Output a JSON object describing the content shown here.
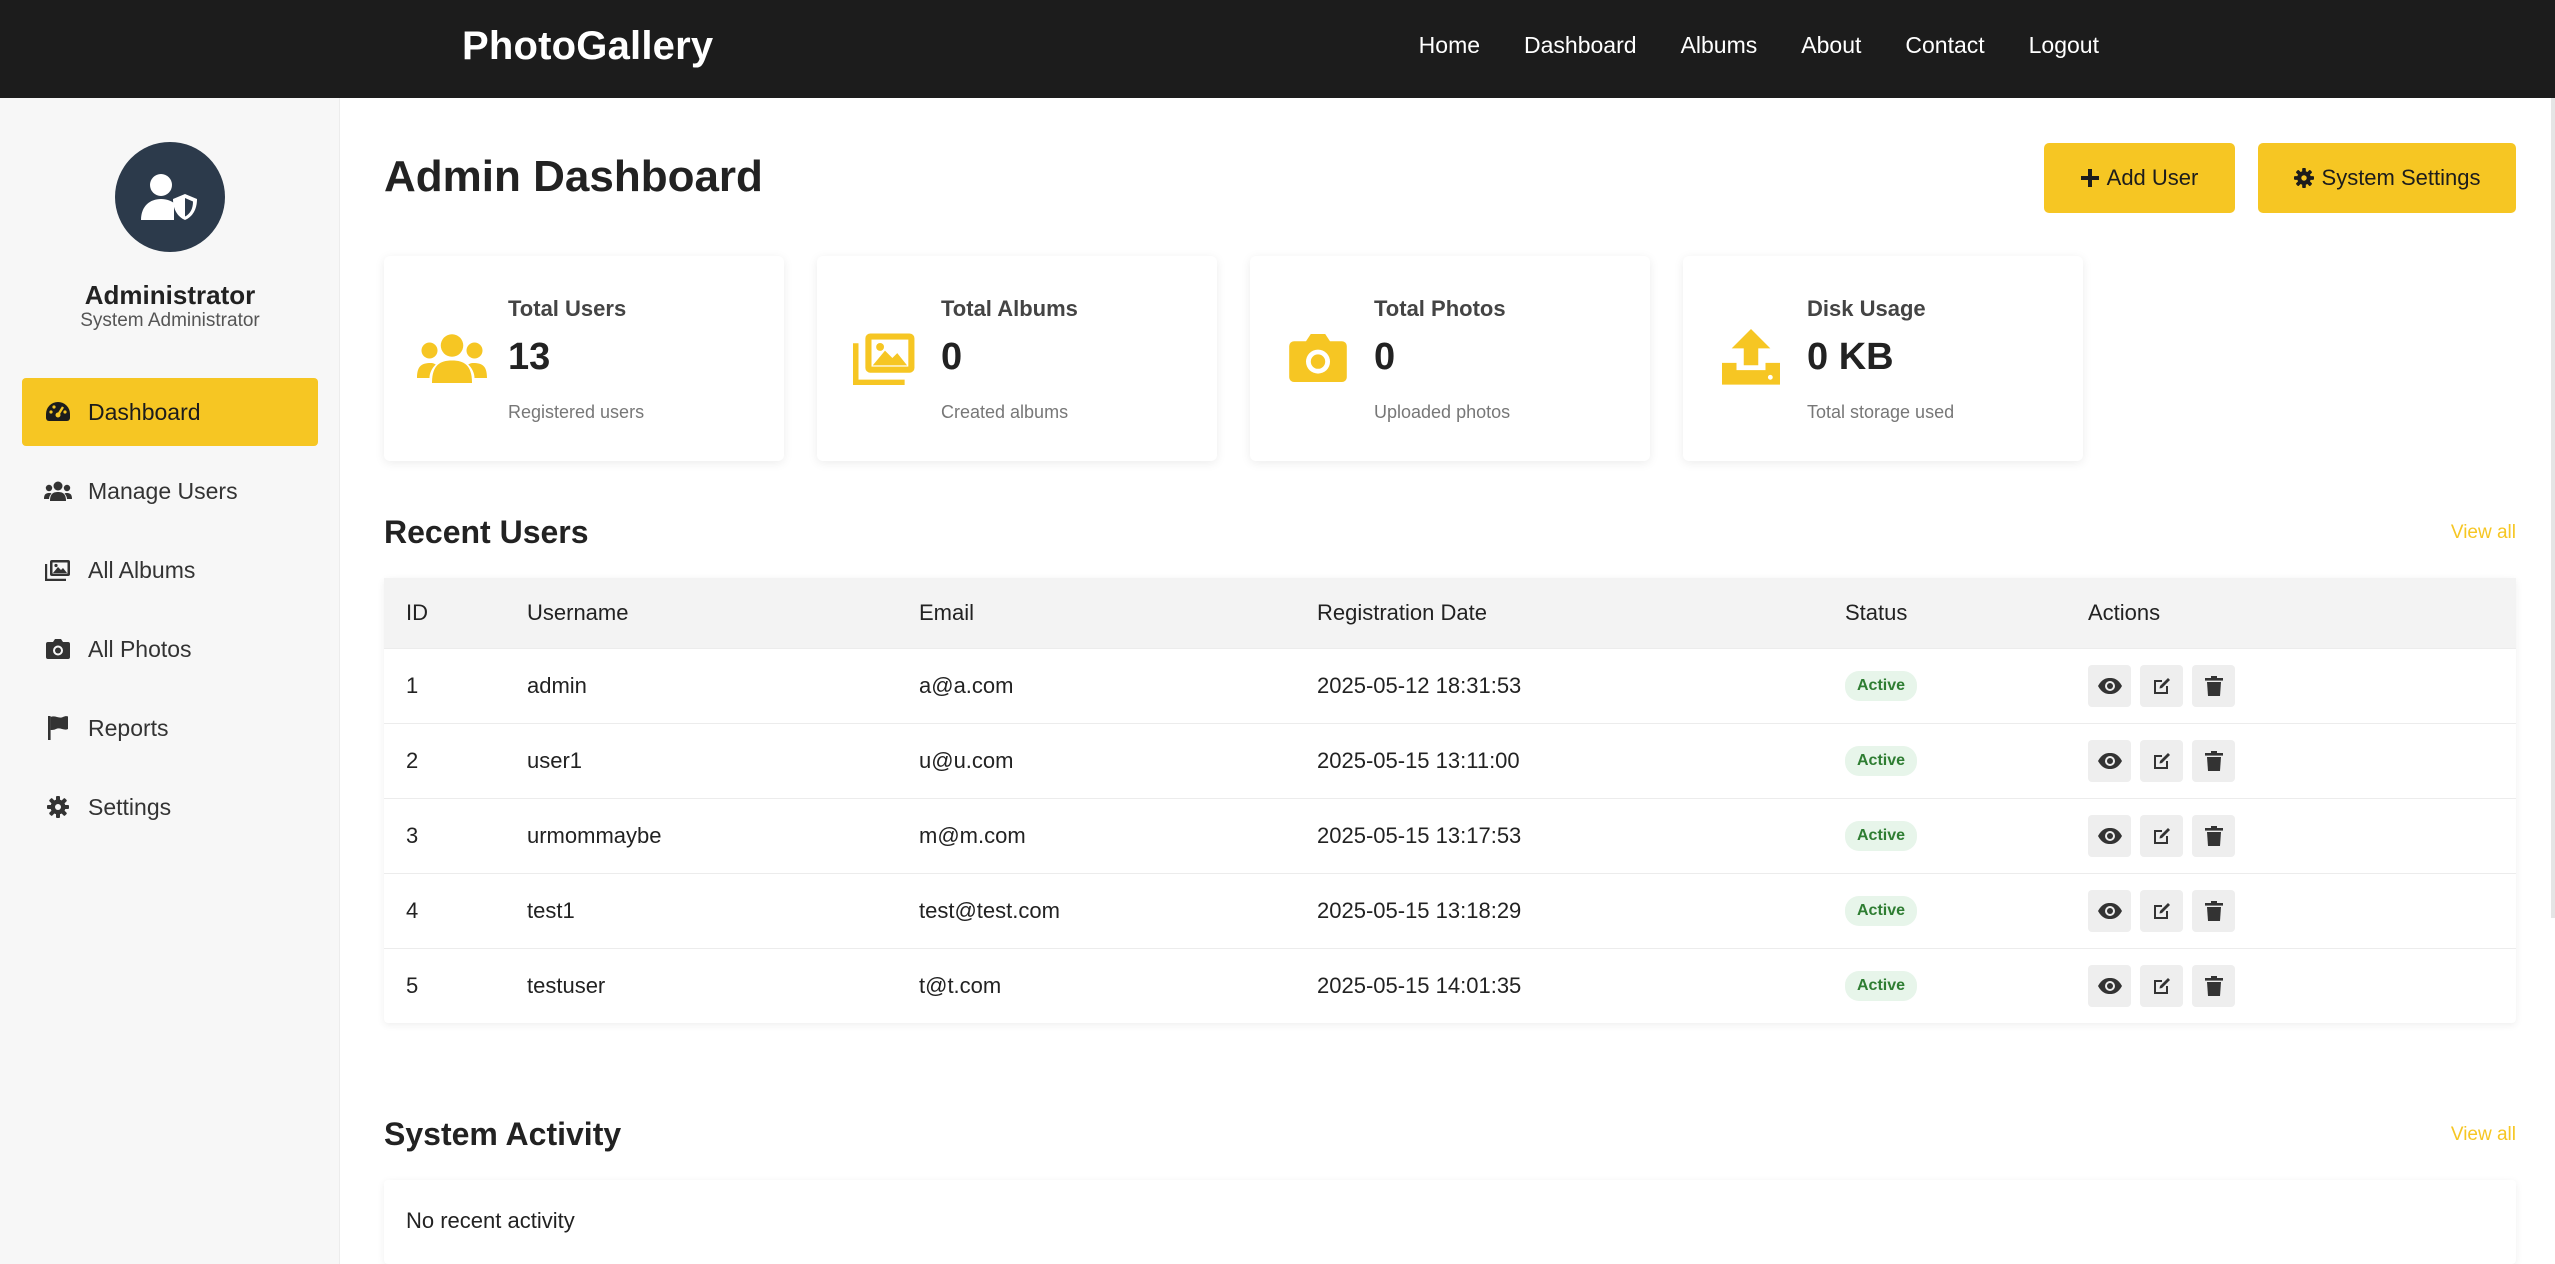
{
  "navbar": {
    "brand": "PhotoGallery",
    "links": [
      "Home",
      "Dashboard",
      "Albums",
      "About",
      "Contact",
      "Logout"
    ]
  },
  "sidebar": {
    "avatar_icon": "user-shield-icon",
    "name": "Administrator",
    "role": "System Administrator",
    "items": [
      {
        "label": "Dashboard",
        "icon": "gauge-icon",
        "active": true
      },
      {
        "label": "Manage Users",
        "icon": "users-icon",
        "active": false
      },
      {
        "label": "All Albums",
        "icon": "images-icon",
        "active": false
      },
      {
        "label": "All Photos",
        "icon": "camera-icon",
        "active": false
      },
      {
        "label": "Reports",
        "icon": "flag-icon",
        "active": false
      },
      {
        "label": "Settings",
        "icon": "gear-icon",
        "active": false
      }
    ]
  },
  "header": {
    "title": "Admin Dashboard",
    "add_user_label": "Add User",
    "system_settings_label": "System Settings"
  },
  "stats": [
    {
      "label": "Total Users",
      "value": "13",
      "sub": "Registered users",
      "icon": "users-icon"
    },
    {
      "label": "Total Albums",
      "value": "0",
      "sub": "Created albums",
      "icon": "images-icon"
    },
    {
      "label": "Total Photos",
      "value": "0",
      "sub": "Uploaded photos",
      "icon": "camera-icon"
    },
    {
      "label": "Disk Usage",
      "value": "0 KB",
      "sub": "Total storage used",
      "icon": "upload-icon"
    }
  ],
  "recent_users": {
    "title": "Recent Users",
    "view_all": "View all",
    "columns": [
      "ID",
      "Username",
      "Email",
      "Registration Date",
      "Status",
      "Actions"
    ],
    "rows": [
      {
        "id": "1",
        "username": "admin",
        "email": "a@a.com",
        "date": "2025-05-12 18:31:53",
        "status": "Active"
      },
      {
        "id": "2",
        "username": "user1",
        "email": "u@u.com",
        "date": "2025-05-15 13:11:00",
        "status": "Active"
      },
      {
        "id": "3",
        "username": "urmommaybe",
        "email": "m@m.com",
        "date": "2025-05-15 13:17:53",
        "status": "Active"
      },
      {
        "id": "4",
        "username": "test1",
        "email": "test@test.com",
        "date": "2025-05-15 13:18:29",
        "status": "Active"
      },
      {
        "id": "5",
        "username": "testuser",
        "email": "t@t.com",
        "date": "2025-05-15 14:01:35",
        "status": "Active"
      }
    ]
  },
  "system_activity": {
    "title": "System Activity",
    "view_all": "View all",
    "empty_text": "No recent activity"
  },
  "colors": {
    "accent": "#f6c623",
    "navbar": "#1c1c1c",
    "avatar_bg": "#2c3a4b",
    "status_active": "#2e7d32"
  }
}
